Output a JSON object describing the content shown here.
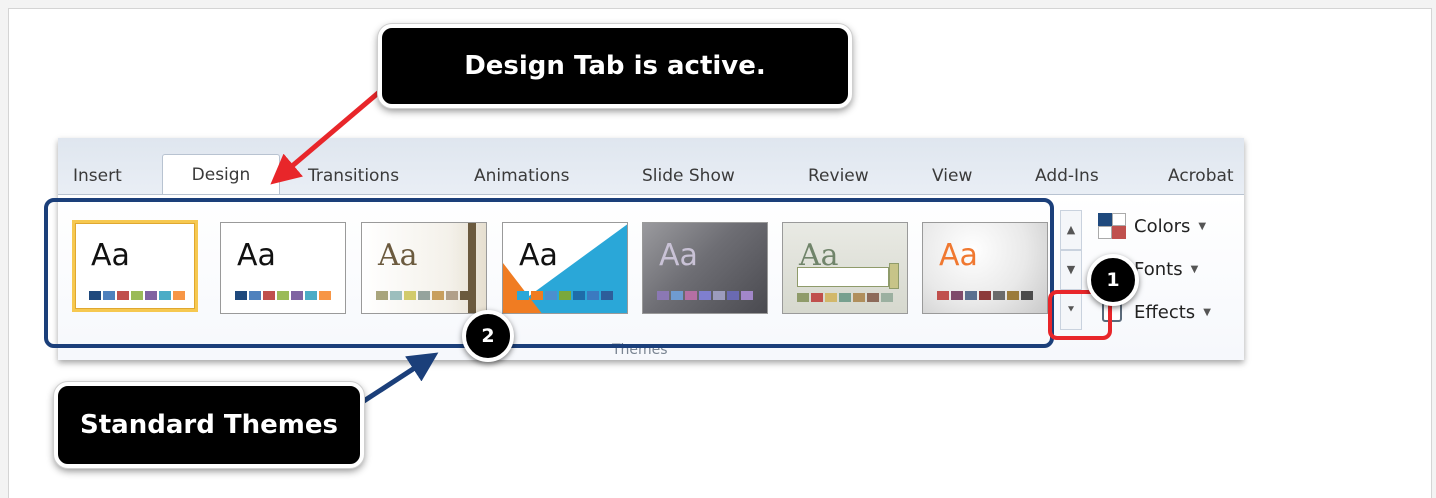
{
  "callouts": {
    "top": "Design Tab is active.",
    "bottom": "Standard Themes"
  },
  "badges": {
    "one": "1",
    "two": "2"
  },
  "ribbon": {
    "tabs": [
      "Insert",
      "Design",
      "Transitions",
      "Animations",
      "Slide Show",
      "Review",
      "View",
      "Add-Ins",
      "Acrobat"
    ],
    "active_tab": "Design",
    "group_label": "Themes",
    "theme_sample_text": "Aa",
    "commands": {
      "colors": "Colors",
      "fonts": "Fonts",
      "effects": "Effects"
    }
  },
  "colors": {
    "callout_bg": "#000000",
    "themes_frame": "#1b3f7a",
    "marker_box": "#e8262a",
    "arrow_red": "#e8262a",
    "arrow_blue": "#1b3f7a",
    "selected_theme": "#f6c850"
  },
  "icons": [
    "chevron-up-icon",
    "chevron-down-icon",
    "more-icon",
    "colors-icon",
    "fonts-icon",
    "effects-icon",
    "caret-down-icon"
  ]
}
